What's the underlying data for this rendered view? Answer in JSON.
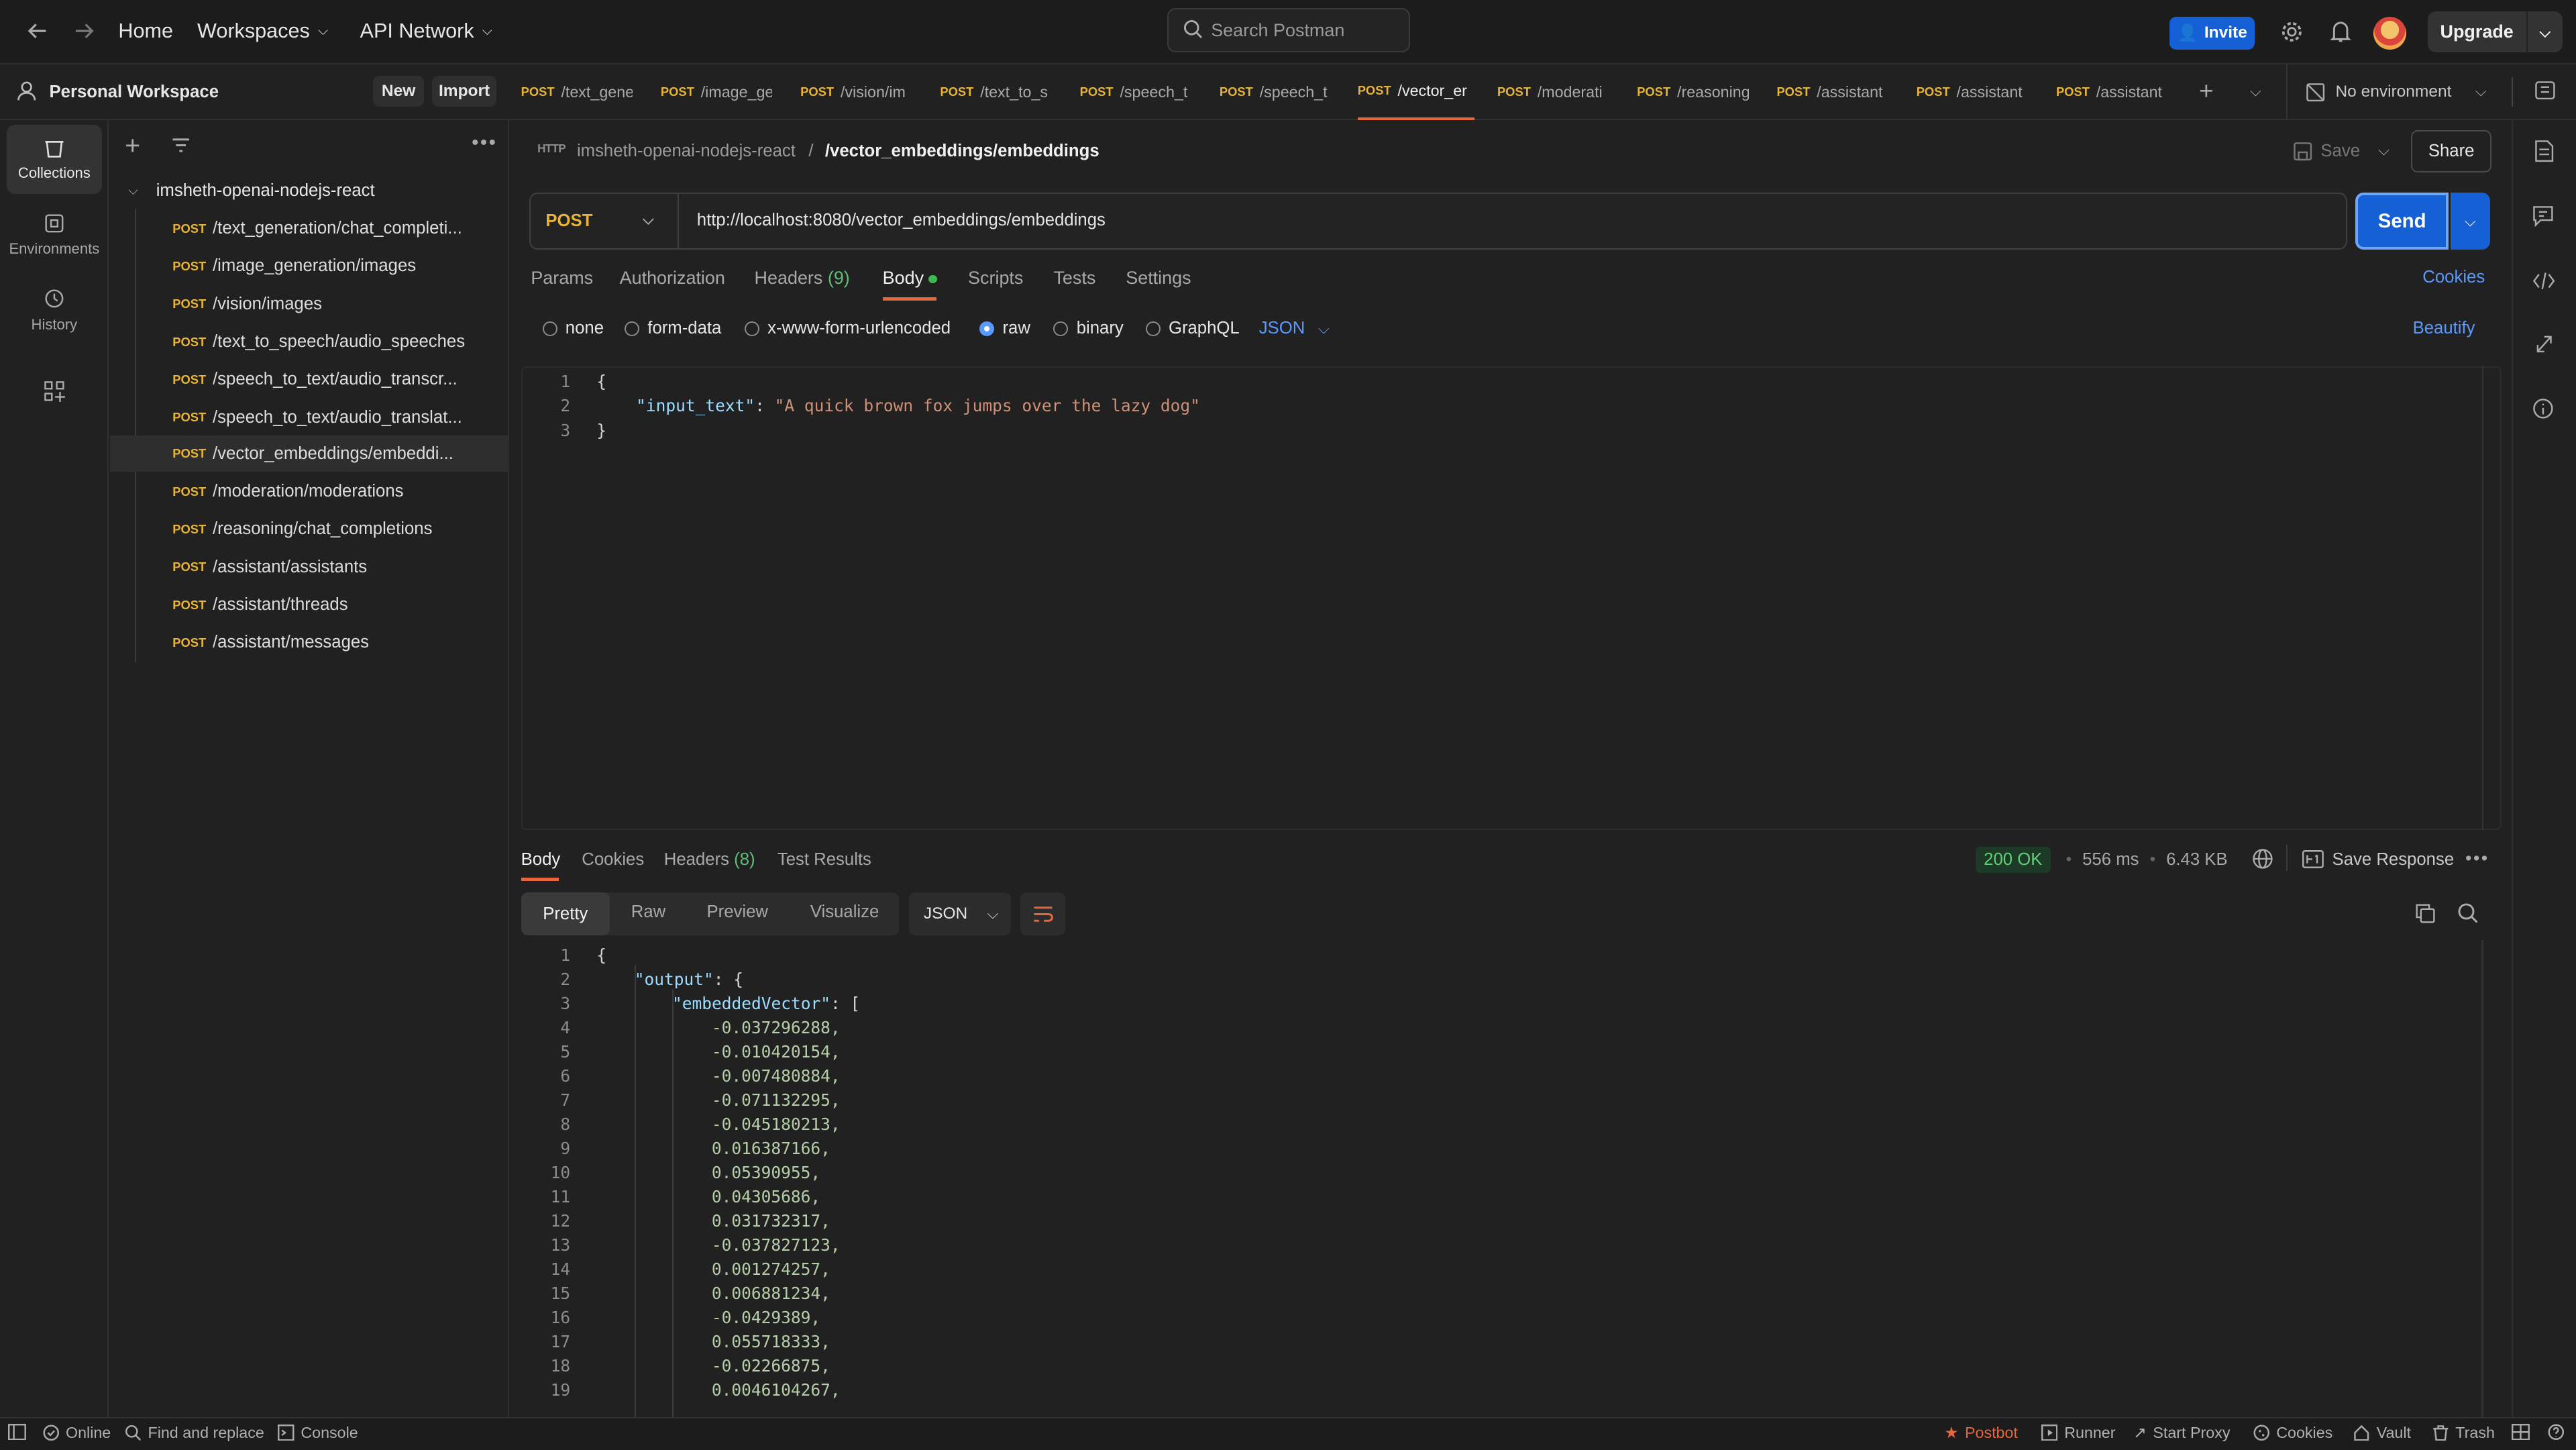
{
  "top": {
    "home": "Home",
    "workspaces": "Workspaces",
    "api_network": "API Network",
    "search_placeholder": "Search Postman",
    "invite": "Invite",
    "upgrade": "Upgrade"
  },
  "workspace": {
    "name": "Personal Workspace",
    "new": "New",
    "import": "Import"
  },
  "tabs": [
    {
      "method": "POST",
      "label": "/text_gene"
    },
    {
      "method": "POST",
      "label": "/image_ge"
    },
    {
      "method": "POST",
      "label": "/vision/im"
    },
    {
      "method": "POST",
      "label": "/text_to_s"
    },
    {
      "method": "POST",
      "label": "/speech_t"
    },
    {
      "method": "POST",
      "label": "/speech_t"
    },
    {
      "method": "POST",
      "label": "/vector_er"
    },
    {
      "method": "POST",
      "label": "/moderati"
    },
    {
      "method": "POST",
      "label": "/reasoning"
    },
    {
      "method": "POST",
      "label": "/assistant"
    },
    {
      "method": "POST",
      "label": "/assistant"
    },
    {
      "method": "POST",
      "label": "/assistant"
    }
  ],
  "environment": "No environment",
  "rail": {
    "collections": "Collections",
    "environments": "Environments",
    "history": "History"
  },
  "collection": {
    "name": "imsheth-openai-nodejs-react",
    "items": [
      {
        "method": "POST",
        "label": "/text_generation/chat_completi..."
      },
      {
        "method": "POST",
        "label": "/image_generation/images"
      },
      {
        "method": "POST",
        "label": "/vision/images"
      },
      {
        "method": "POST",
        "label": "/text_to_speech/audio_speeches"
      },
      {
        "method": "POST",
        "label": "/speech_to_text/audio_transcr..."
      },
      {
        "method": "POST",
        "label": "/speech_to_text/audio_translat..."
      },
      {
        "method": "POST",
        "label": "/vector_embeddings/embeddi..."
      },
      {
        "method": "POST",
        "label": "/moderation/moderations"
      },
      {
        "method": "POST",
        "label": "/reasoning/chat_completions"
      },
      {
        "method": "POST",
        "label": "/assistant/assistants"
      },
      {
        "method": "POST",
        "label": "/assistant/threads"
      },
      {
        "method": "POST",
        "label": "/assistant/messages"
      }
    ]
  },
  "request": {
    "breadcrumb_parent": "imsheth-openai-nodejs-react",
    "breadcrumb_sep": "/",
    "breadcrumb_current": "/vector_embeddings/embeddings",
    "save": "Save",
    "share": "Share",
    "method": "POST",
    "url": "http://localhost:8080/vector_embeddings/embeddings",
    "send": "Send",
    "tabs": {
      "params": "Params",
      "authorization": "Authorization",
      "headers": "Headers",
      "headers_count": "(9)",
      "body": "Body",
      "scripts": "Scripts",
      "tests": "Tests",
      "settings": "Settings",
      "cookies": "Cookies"
    },
    "body_types": {
      "none": "none",
      "form_data": "form-data",
      "urlencoded": "x-www-form-urlencoded",
      "raw": "raw",
      "binary": "binary",
      "graphql": "GraphQL",
      "json": "JSON",
      "beautify": "Beautify"
    },
    "body_lines": {
      "l1": "{",
      "key": "\"input_text\"",
      "colon": ": ",
      "value": "\"A quick brown fox jumps over the lazy dog\"",
      "l3": "}"
    }
  },
  "response": {
    "tabs": {
      "body": "Body",
      "cookies": "Cookies",
      "headers": "Headers",
      "headers_count": "(8)",
      "test_results": "Test Results"
    },
    "status": "200 OK",
    "time": "556 ms",
    "size": "6.43 KB",
    "save_response": "Save Response",
    "views": {
      "pretty": "Pretty",
      "raw": "Raw",
      "preview": "Preview",
      "visualize": "Visualize",
      "format": "JSON"
    },
    "open": "{",
    "output_key": "\"output\"",
    "output_rest": ": {",
    "vec_key": "\"embeddedVector\"",
    "vec_rest": ": [",
    "values": [
      "-0.037296288,",
      "-0.010420154,",
      "-0.007480884,",
      "-0.071132295,",
      "-0.045180213,",
      "0.016387166,",
      "0.05390955,",
      "0.04305686,",
      "0.031732317,",
      "-0.037827123,",
      "0.001274257,",
      "0.006881234,",
      "-0.0429389,",
      "0.055718333,",
      "-0.02266875,",
      "0.0046104267,"
    ]
  },
  "statusbar": {
    "online": "Online",
    "find_replace": "Find and replace",
    "console": "Console",
    "postbot": "Postbot",
    "runner": "Runner",
    "start_proxy": "Start Proxy",
    "cookies": "Cookies",
    "vault": "Vault",
    "trash": "Trash"
  }
}
